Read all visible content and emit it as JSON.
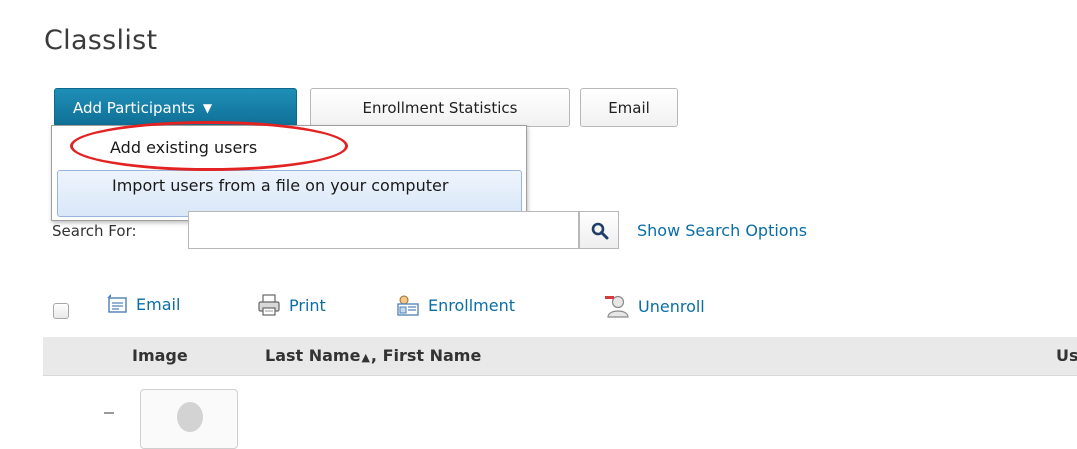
{
  "page": {
    "title": "Classlist"
  },
  "toolbar": {
    "add_participants": "Add Participants",
    "enrollment_statistics": "Enrollment Statistics",
    "email": "Email"
  },
  "add_menu": {
    "items": [
      "Add existing users",
      "Import users from a file on your computer"
    ]
  },
  "search": {
    "label": "Search For:",
    "value": "",
    "placeholder": "",
    "options_link": "Show Search Options"
  },
  "actions": {
    "email": "Email",
    "print": "Print",
    "enrollment": "Enrollment",
    "unenroll": "Unenroll"
  },
  "table": {
    "headers": [
      "Image",
      "Last Name",
      ", First Name",
      "Us"
    ]
  },
  "colors": {
    "primary": "#1380aa",
    "link": "#0a6ea6",
    "highlight_ring": "#e32222"
  }
}
